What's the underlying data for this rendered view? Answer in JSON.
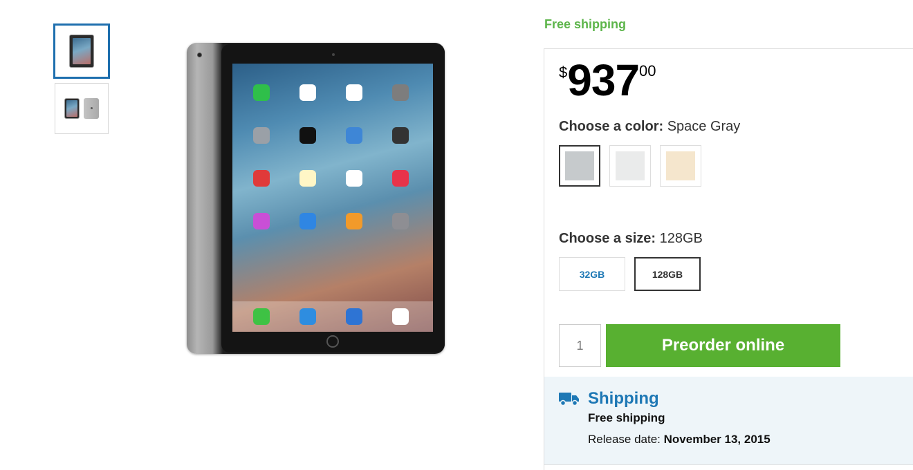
{
  "top": {
    "free_shipping": "Free shipping"
  },
  "price": {
    "currency": "$",
    "whole": "937",
    "cents": "00"
  },
  "color": {
    "label": "Choose a color:",
    "selected": "Space Gray",
    "swatches": [
      {
        "name": "Space Gray",
        "hex": "#c6cacc",
        "selected": true
      },
      {
        "name": "Silver",
        "hex": "#eaebeb",
        "selected": false
      },
      {
        "name": "Gold",
        "hex": "#f5e6cd",
        "selected": false
      }
    ]
  },
  "size": {
    "label": "Choose a size:",
    "selected": "128GB",
    "options": [
      {
        "label": "32GB",
        "selected": false
      },
      {
        "label": "128GB",
        "selected": true
      }
    ]
  },
  "quantity": {
    "value": "1"
  },
  "preorder": {
    "label": "Preorder online"
  },
  "shipping": {
    "title": "Shipping",
    "free": "Free shipping",
    "release_label": "Release date:",
    "release_date": "November 13, 2015"
  },
  "colors": {
    "accent_green": "#58b031",
    "free_green": "#5cb54a",
    "link_blue": "#1e78b5",
    "thumb_border": "#1e6fae",
    "shipping_bg": "#eef5f9"
  },
  "icons": [
    "truck-icon",
    "camera-icon"
  ]
}
